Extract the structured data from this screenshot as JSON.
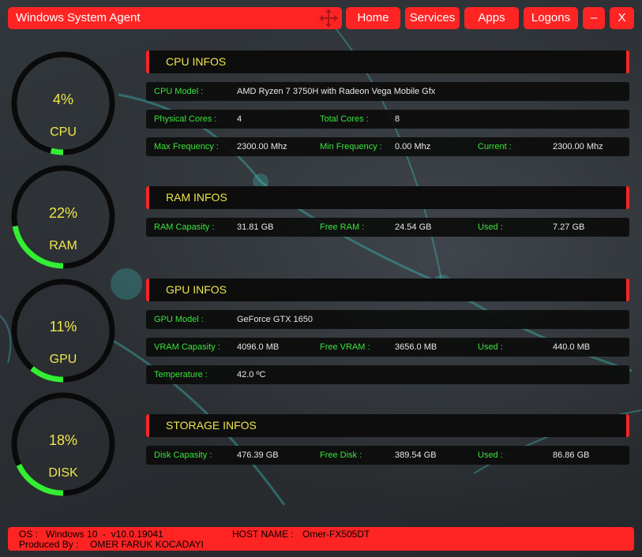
{
  "window": {
    "title": "Windows System Agent",
    "nav": {
      "home": "Home",
      "services": "Services",
      "apps": "Apps",
      "logons": "Logons",
      "minimize": "–",
      "close": "X"
    }
  },
  "gauges": [
    {
      "name": "CPU",
      "percent_text": "4%",
      "value": 0.04
    },
    {
      "name": "RAM",
      "percent_text": "22%",
      "value": 0.22
    },
    {
      "name": "GPU",
      "percent_text": "11%",
      "value": 0.11
    },
    {
      "name": "DISK",
      "percent_text": "18%",
      "value": 0.18
    }
  ],
  "cpu": {
    "header": "CPU INFOS",
    "model_label": "CPU Model :",
    "model": "AMD Ryzen 7 3750H with Radeon Vega Mobile Gfx",
    "physical_cores_label": "Physical Cores :",
    "physical_cores": "4",
    "total_cores_label": "Total Cores :",
    "total_cores": "8",
    "max_freq_label": "Max Frequency :",
    "max_freq": "2300.00 Mhz",
    "min_freq_label": "Min Frequency :",
    "min_freq": "0.00 Mhz",
    "current_label": "Current :",
    "current": "2300.00 Mhz"
  },
  "ram": {
    "header": "RAM INFOS",
    "capacity_label": "RAM Capasity :",
    "capacity": "31.81 GB",
    "free_label": "Free RAM :",
    "free": "24.54 GB",
    "used_label": "Used :",
    "used": "7.27 GB"
  },
  "gpu": {
    "header": "GPU INFOS",
    "model_label": "GPU Model :",
    "model": "GeForce GTX 1650",
    "vram_label": "VRAM Capasity :",
    "vram": "4096.0 MB",
    "free_vram_label": "Free VRAM :",
    "free_vram": "3656.0 MB",
    "used_label": "Used :",
    "used": "440.0 MB",
    "temp_label": "Temperature :",
    "temp": "42.0 ºC"
  },
  "storage": {
    "header": "STORAGE INFOS",
    "capacity_label": "Disk Capasity :",
    "capacity": "476.39 GB",
    "free_label": "Free Disk :",
    "free": "389.54 GB",
    "used_label": "Used :",
    "used": "86.86 GB"
  },
  "footer": {
    "os_label": "OS :",
    "os_value": "Windows 10  -  v10.0.19041",
    "host_label": "HOST NAME :",
    "host_value": "Omer-FX505DT",
    "producer_label": "Produced By :",
    "producer_value": "OMER FARUK KOCADAYI"
  },
  "colors": {
    "accent": "#ff2424",
    "label": "#39e639",
    "header_text": "#f0e64a",
    "gauge_track": "#0a0a0a",
    "gauge_fill": "#33ee33"
  },
  "icons": {
    "move": "move-arrows-icon"
  }
}
